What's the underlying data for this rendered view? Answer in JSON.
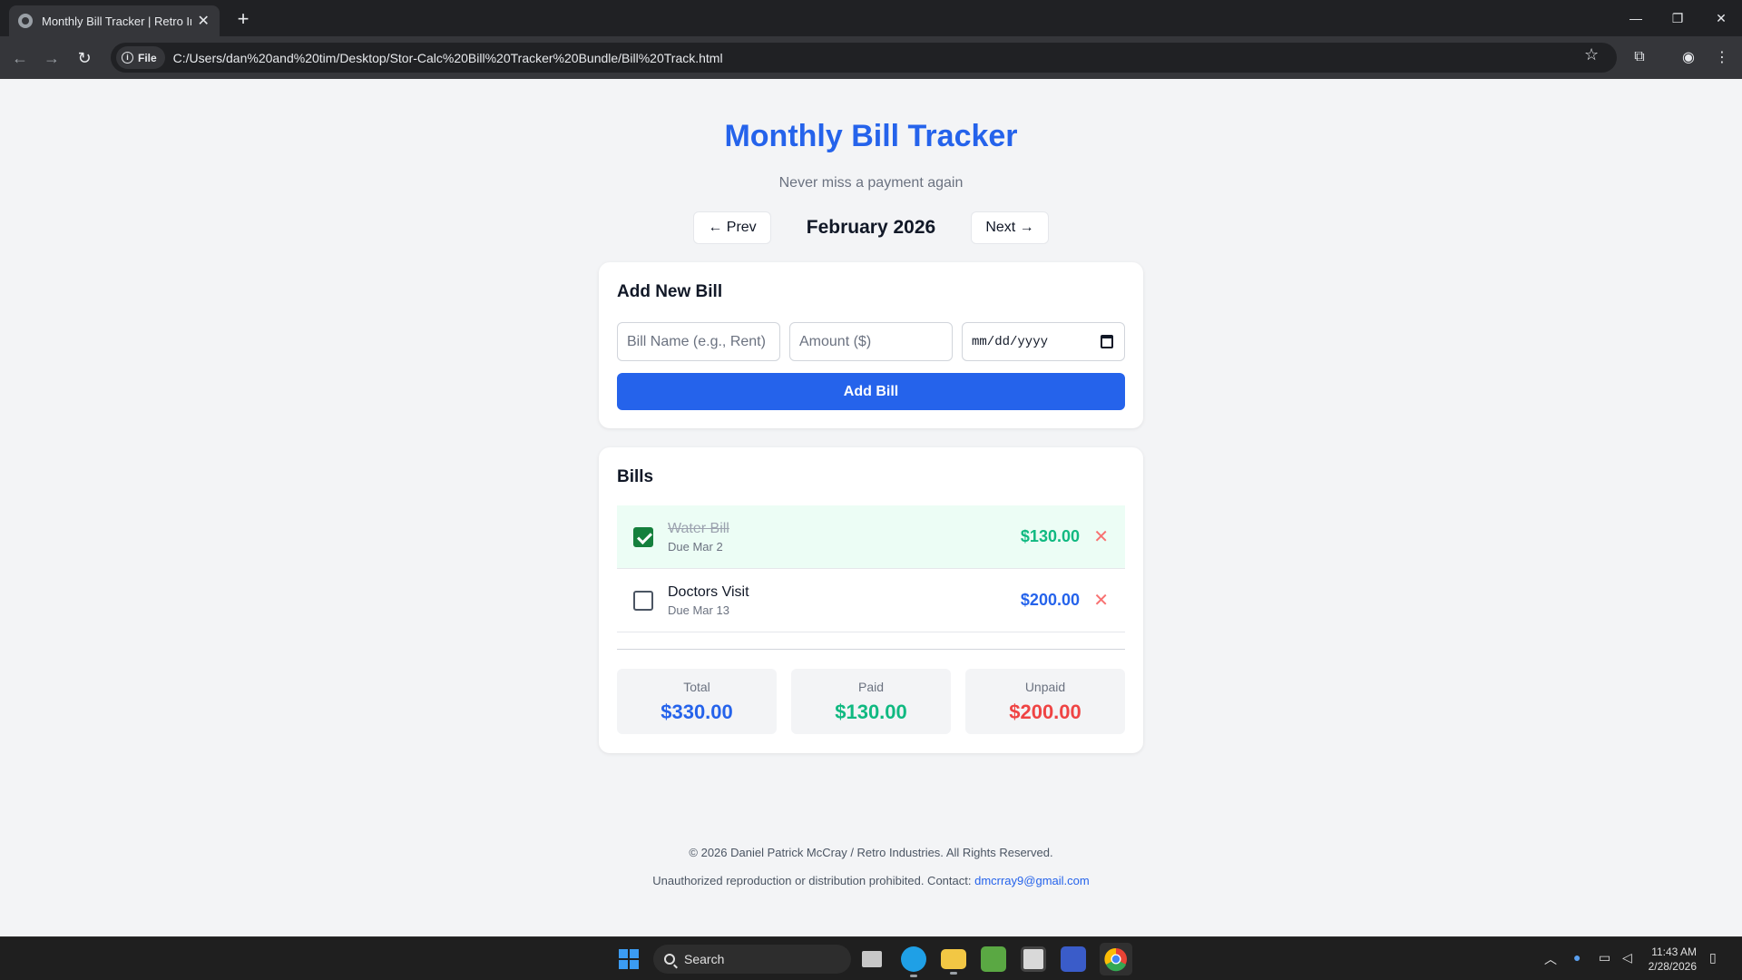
{
  "browser": {
    "tab_title": "Monthly Bill Tracker | Retro Industries",
    "new_tab": "+",
    "site_chip": "File",
    "url": "C:/Users/dan%20and%20tim/Desktop/Stor-Calc%20Bill%20Tracker%20Bundle/Bill%20Track.html"
  },
  "header": {
    "title": "Monthly Bill Tracker",
    "subtitle": "Never miss a payment again",
    "prev_label": "← Prev",
    "next_label": "Next →",
    "month": "February 2026"
  },
  "add_form": {
    "heading": "Add New Bill",
    "name_placeholder": "Bill Name (e.g., Rent)",
    "amount_placeholder": "Amount ($)",
    "date_placeholder": "mm/dd/yyyy",
    "add_button": "Add Bill"
  },
  "bills": {
    "heading": "Bills",
    "items": [
      {
        "name": "Water Bill",
        "due": "Due Mar 2",
        "amount": "$130.00",
        "paid": true,
        "delete": "✕"
      },
      {
        "name": "Doctors Visit",
        "due": "Due Mar 13",
        "amount": "$200.00",
        "paid": false,
        "delete": "✕"
      }
    ]
  },
  "summary": {
    "total_label": "Total",
    "total_value": "$330.00",
    "paid_label": "Paid",
    "paid_value": "$130.00",
    "unpaid_label": "Unpaid",
    "unpaid_value": "$200.00"
  },
  "footer": {
    "copyright": "© 2026 Daniel Patrick McCray / Retro Industries. All Rights Reserved.",
    "notice": "Unauthorized reproduction or distribution prohibited. Contact: ",
    "email": "dmcrray9@gmail.com"
  },
  "taskbar": {
    "search_label": "Search",
    "time": "11:43 AM",
    "date": "2/28/2026"
  },
  "colors": {
    "accent": "#2563eb",
    "paid": "#10b981",
    "unpaid": "#ef4444"
  }
}
